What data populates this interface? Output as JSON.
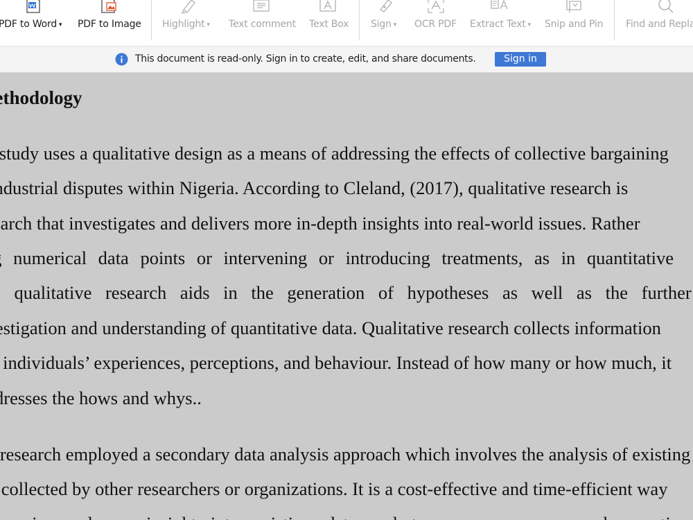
{
  "toolbar": {
    "tools": [
      {
        "id": "pdf-to-word",
        "label": "PDF to Word",
        "has_menu": true,
        "enabled": true,
        "icon": "word-file-icon"
      },
      {
        "id": "pdf-to-image",
        "label": "PDF to Image",
        "has_menu": false,
        "enabled": true,
        "icon": "image-file-icon"
      },
      {
        "id": "highlight",
        "label": "Highlight",
        "has_menu": true,
        "enabled": false,
        "icon": "highlighter-icon"
      },
      {
        "id": "text-comment",
        "label": "Text comment",
        "has_menu": false,
        "enabled": false,
        "icon": "text-comment-icon"
      },
      {
        "id": "text-box",
        "label": "Text Box",
        "has_menu": false,
        "enabled": false,
        "icon": "text-box-icon"
      },
      {
        "id": "sign",
        "label": "Sign",
        "has_menu": true,
        "enabled": false,
        "icon": "pen-sign-icon"
      },
      {
        "id": "ocr-pdf",
        "label": "OCR PDF",
        "has_menu": false,
        "enabled": false,
        "icon": "ocr-scan-icon"
      },
      {
        "id": "extract-text",
        "label": "Extract Text",
        "has_menu": true,
        "enabled": false,
        "icon": "extract-text-icon"
      },
      {
        "id": "snip-and-pin",
        "label": "Snip and Pin",
        "has_menu": false,
        "enabled": false,
        "icon": "snip-pin-icon"
      },
      {
        "id": "find-and-replace",
        "label": "Find and Replace",
        "has_menu": false,
        "enabled": false,
        "icon": "search-icon"
      }
    ],
    "caret_glyph": "▾"
  },
  "infobar": {
    "message": "This document is read-only. Sign in to create, edit, and share documents.",
    "sign_in_label": "Sign in",
    "accent_color": "#3e78d6",
    "icon": "info-icon"
  },
  "document": {
    "heading": "Methodology",
    "paragraphs": [
      [
        "This study uses a qualitative design as a means of addressing the effects of collective bargaining",
        "on industrial disputes within Nigeria. According to Cleland, (2017), qualitative research is",
        "research that investigates and delivers more in-depth insights into real-world issues. Rather",
        "collecting numerical data points or intervening or introducing treatments, as in quantitative",
        "research, qualitative research aids in the generation of hypotheses as well as the further",
        "investigation and understanding of quantitative data. Qualitative research collects information",
        "on individuals’ experiences, perceptions, and behaviour. Instead of how many or how much, it",
        "addresses the hows and whys.."
      ],
      [
        "The research employed a secondary data analysis approach which  involves the analysis of existing",
        "data collected by other researchers or organizations. It is a cost-effective and time-efficient way",
        "to gain a deeper insight into existing data and to answer new research questions. The"
      ]
    ]
  }
}
